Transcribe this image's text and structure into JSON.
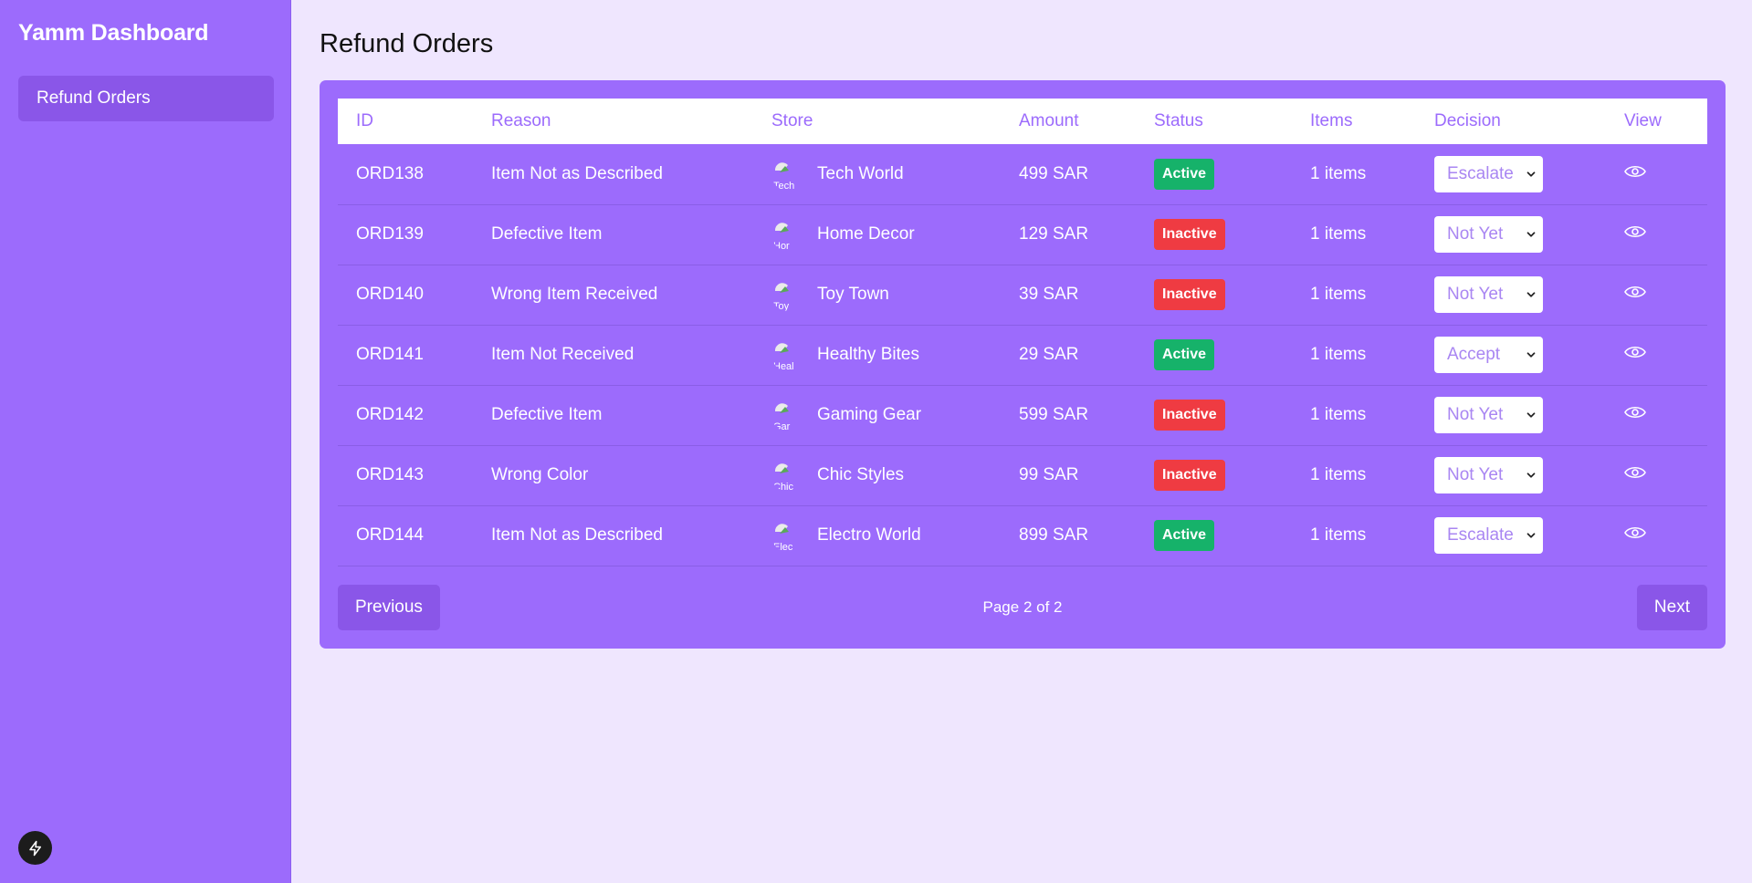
{
  "sidebar": {
    "brand": "Yamm Dashboard",
    "items": [
      {
        "label": "Refund Orders"
      }
    ]
  },
  "page": {
    "title": "Refund Orders"
  },
  "table": {
    "columns": [
      "ID",
      "Reason",
      "Store",
      "Amount",
      "Status",
      "Items",
      "Decision",
      "View"
    ],
    "rows": [
      {
        "id": "ORD138",
        "reason": "Item Not as Described",
        "store": "Tech World",
        "store_img_alt": "Tech",
        "amount": "499 SAR",
        "status": "Active",
        "items": "1 items",
        "decision": "Escalate"
      },
      {
        "id": "ORD139",
        "reason": "Defective Item",
        "store": "Home Decor",
        "store_img_alt": "Hor",
        "amount": "129 SAR",
        "status": "Inactive",
        "items": "1 items",
        "decision": "Not Yet"
      },
      {
        "id": "ORD140",
        "reason": "Wrong Item Received",
        "store": "Toy Town",
        "store_img_alt": "Toy",
        "amount": "39 SAR",
        "status": "Inactive",
        "items": "1 items",
        "decision": "Not Yet"
      },
      {
        "id": "ORD141",
        "reason": "Item Not Received",
        "store": "Healthy Bites",
        "store_img_alt": "Heal",
        "amount": "29 SAR",
        "status": "Active",
        "items": "1 items",
        "decision": "Accept"
      },
      {
        "id": "ORD142",
        "reason": "Defective Item",
        "store": "Gaming Gear",
        "store_img_alt": "Gar",
        "amount": "599 SAR",
        "status": "Inactive",
        "items": "1 items",
        "decision": "Not Yet"
      },
      {
        "id": "ORD143",
        "reason": "Wrong Color",
        "store": "Chic Styles",
        "store_img_alt": "Chic",
        "amount": "99 SAR",
        "status": "Inactive",
        "items": "1 items",
        "decision": "Not Yet"
      },
      {
        "id": "ORD144",
        "reason": "Item Not as Described",
        "store": "Electro World",
        "store_img_alt": "Elec",
        "amount": "899 SAR",
        "status": "Active",
        "items": "1 items",
        "decision": "Escalate"
      }
    ]
  },
  "pagination": {
    "previous_label": "Previous",
    "page_info": "Page 2 of 2",
    "next_label": "Next"
  },
  "colors": {
    "accent": "#9c6bfc",
    "active": "#16b26a",
    "inactive": "#ef3b42"
  },
  "icons": {
    "view": "eye-icon",
    "decision_caret": "chevron-down-icon",
    "dev_badge": "lightning-icon",
    "store_image": "broken-image-icon"
  }
}
